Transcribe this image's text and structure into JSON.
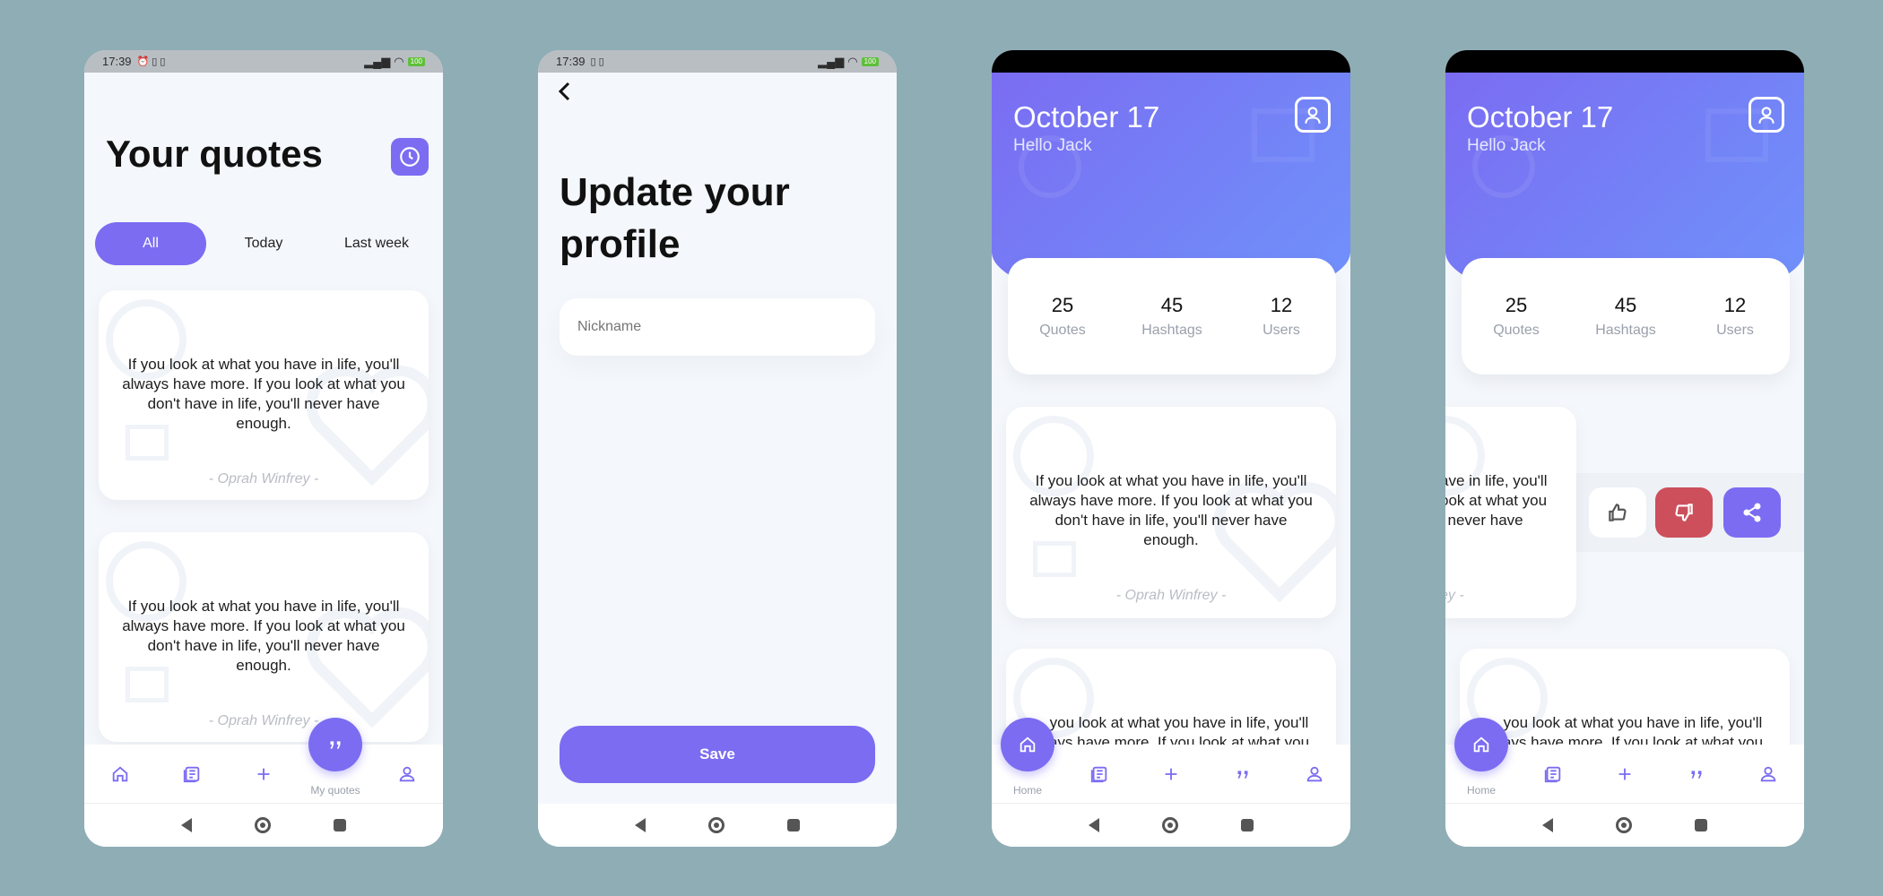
{
  "status": {
    "time": "17:39",
    "battery": "100"
  },
  "screen1": {
    "title": "Your quotes",
    "tabs": [
      "All",
      "Today",
      "Last week"
    ],
    "quotes": [
      {
        "text": "If you look at what you have in life, you'll always have more. If you look at what you don't have in life, you'll never have enough.",
        "author": "- Oprah Winfrey -"
      },
      {
        "text": "If you look at what you have in life, you'll always have more. If you look at what you don't have in life, you'll never have enough.",
        "author": "- Oprah Winfrey -"
      }
    ],
    "fab_label": "My quotes"
  },
  "screen2": {
    "title": "Update your profile",
    "nickname_placeholder": "Nickname",
    "save_label": "Save"
  },
  "home": {
    "date": "October 17",
    "greeting": "Hello Jack",
    "stats": [
      {
        "value": "25",
        "label": "Quotes"
      },
      {
        "value": "45",
        "label": "Hashtags"
      },
      {
        "value": "12",
        "label": "Users"
      }
    ],
    "quote": {
      "text": "If you look at what you have in life, you'll always have more. If you look at what you don't have in life, you'll never have enough.",
      "author": "- Oprah Winfrey -"
    },
    "quote2_partial": "you look at what you have in life, you'll",
    "quote2_partial2": "ays have more. If you look at what you",
    "fab_label": "Home"
  },
  "screen4": {
    "partial_lines": [
      "ave in life, you'll",
      "ook at what you",
      "l never have"
    ],
    "partial_author": "ey -"
  },
  "colors": {
    "accent": "#7b6cf2",
    "dislike": "#cc4f5b",
    "background": "#8fadb5"
  }
}
